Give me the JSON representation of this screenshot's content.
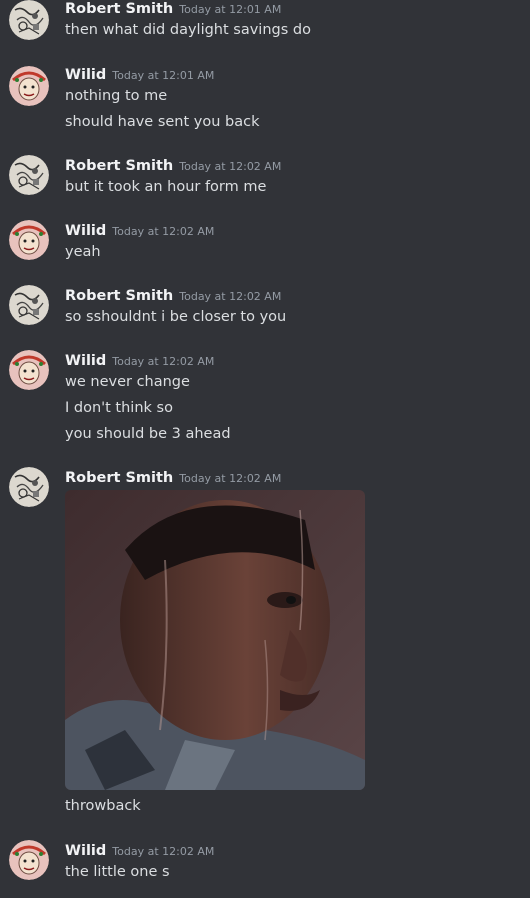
{
  "users": {
    "robert": {
      "name": "Robert Smith",
      "avatar_icon": "sketch-drawing-avatar-icon"
    },
    "wilid": {
      "name": "Wilid",
      "avatar_icon": "cartoon-face-avatar-icon"
    }
  },
  "messages": [
    {
      "author": "Robert Smith",
      "timestamp": "Today at 12:01 AM",
      "lines": [
        "then what did daylight savings do"
      ]
    },
    {
      "author": "Wilid",
      "timestamp": "Today at 12:01 AM",
      "lines": [
        "nothing to me",
        "should have sent you back"
      ]
    },
    {
      "author": "Robert Smith",
      "timestamp": "Today at 12:02 AM",
      "lines": [
        "but it took an hour form me"
      ]
    },
    {
      "author": "Wilid",
      "timestamp": "Today at 12:02 AM",
      "lines": [
        "yeah"
      ]
    },
    {
      "author": "Robert Smith",
      "timestamp": "Today at 12:02 AM",
      "lines": [
        "so sshouldnt i be closer to you"
      ]
    },
    {
      "author": "Wilid",
      "timestamp": "Today at 12:02 AM",
      "lines": [
        "we never change",
        "I don't think so",
        "you should be 3 ahead"
      ]
    },
    {
      "author": "Robert Smith",
      "timestamp": "Today at 12:02 AM",
      "image": "sweating-man-gif",
      "lines": [
        "throwback"
      ]
    },
    {
      "author": "Wilid",
      "timestamp": "Today at 12:02 AM",
      "lines": [
        "the little one s"
      ]
    }
  ],
  "colors": {
    "background": "#313338",
    "username": "#f2f3f5",
    "timestamp": "#949ba4",
    "message_text": "#dbdee1"
  }
}
